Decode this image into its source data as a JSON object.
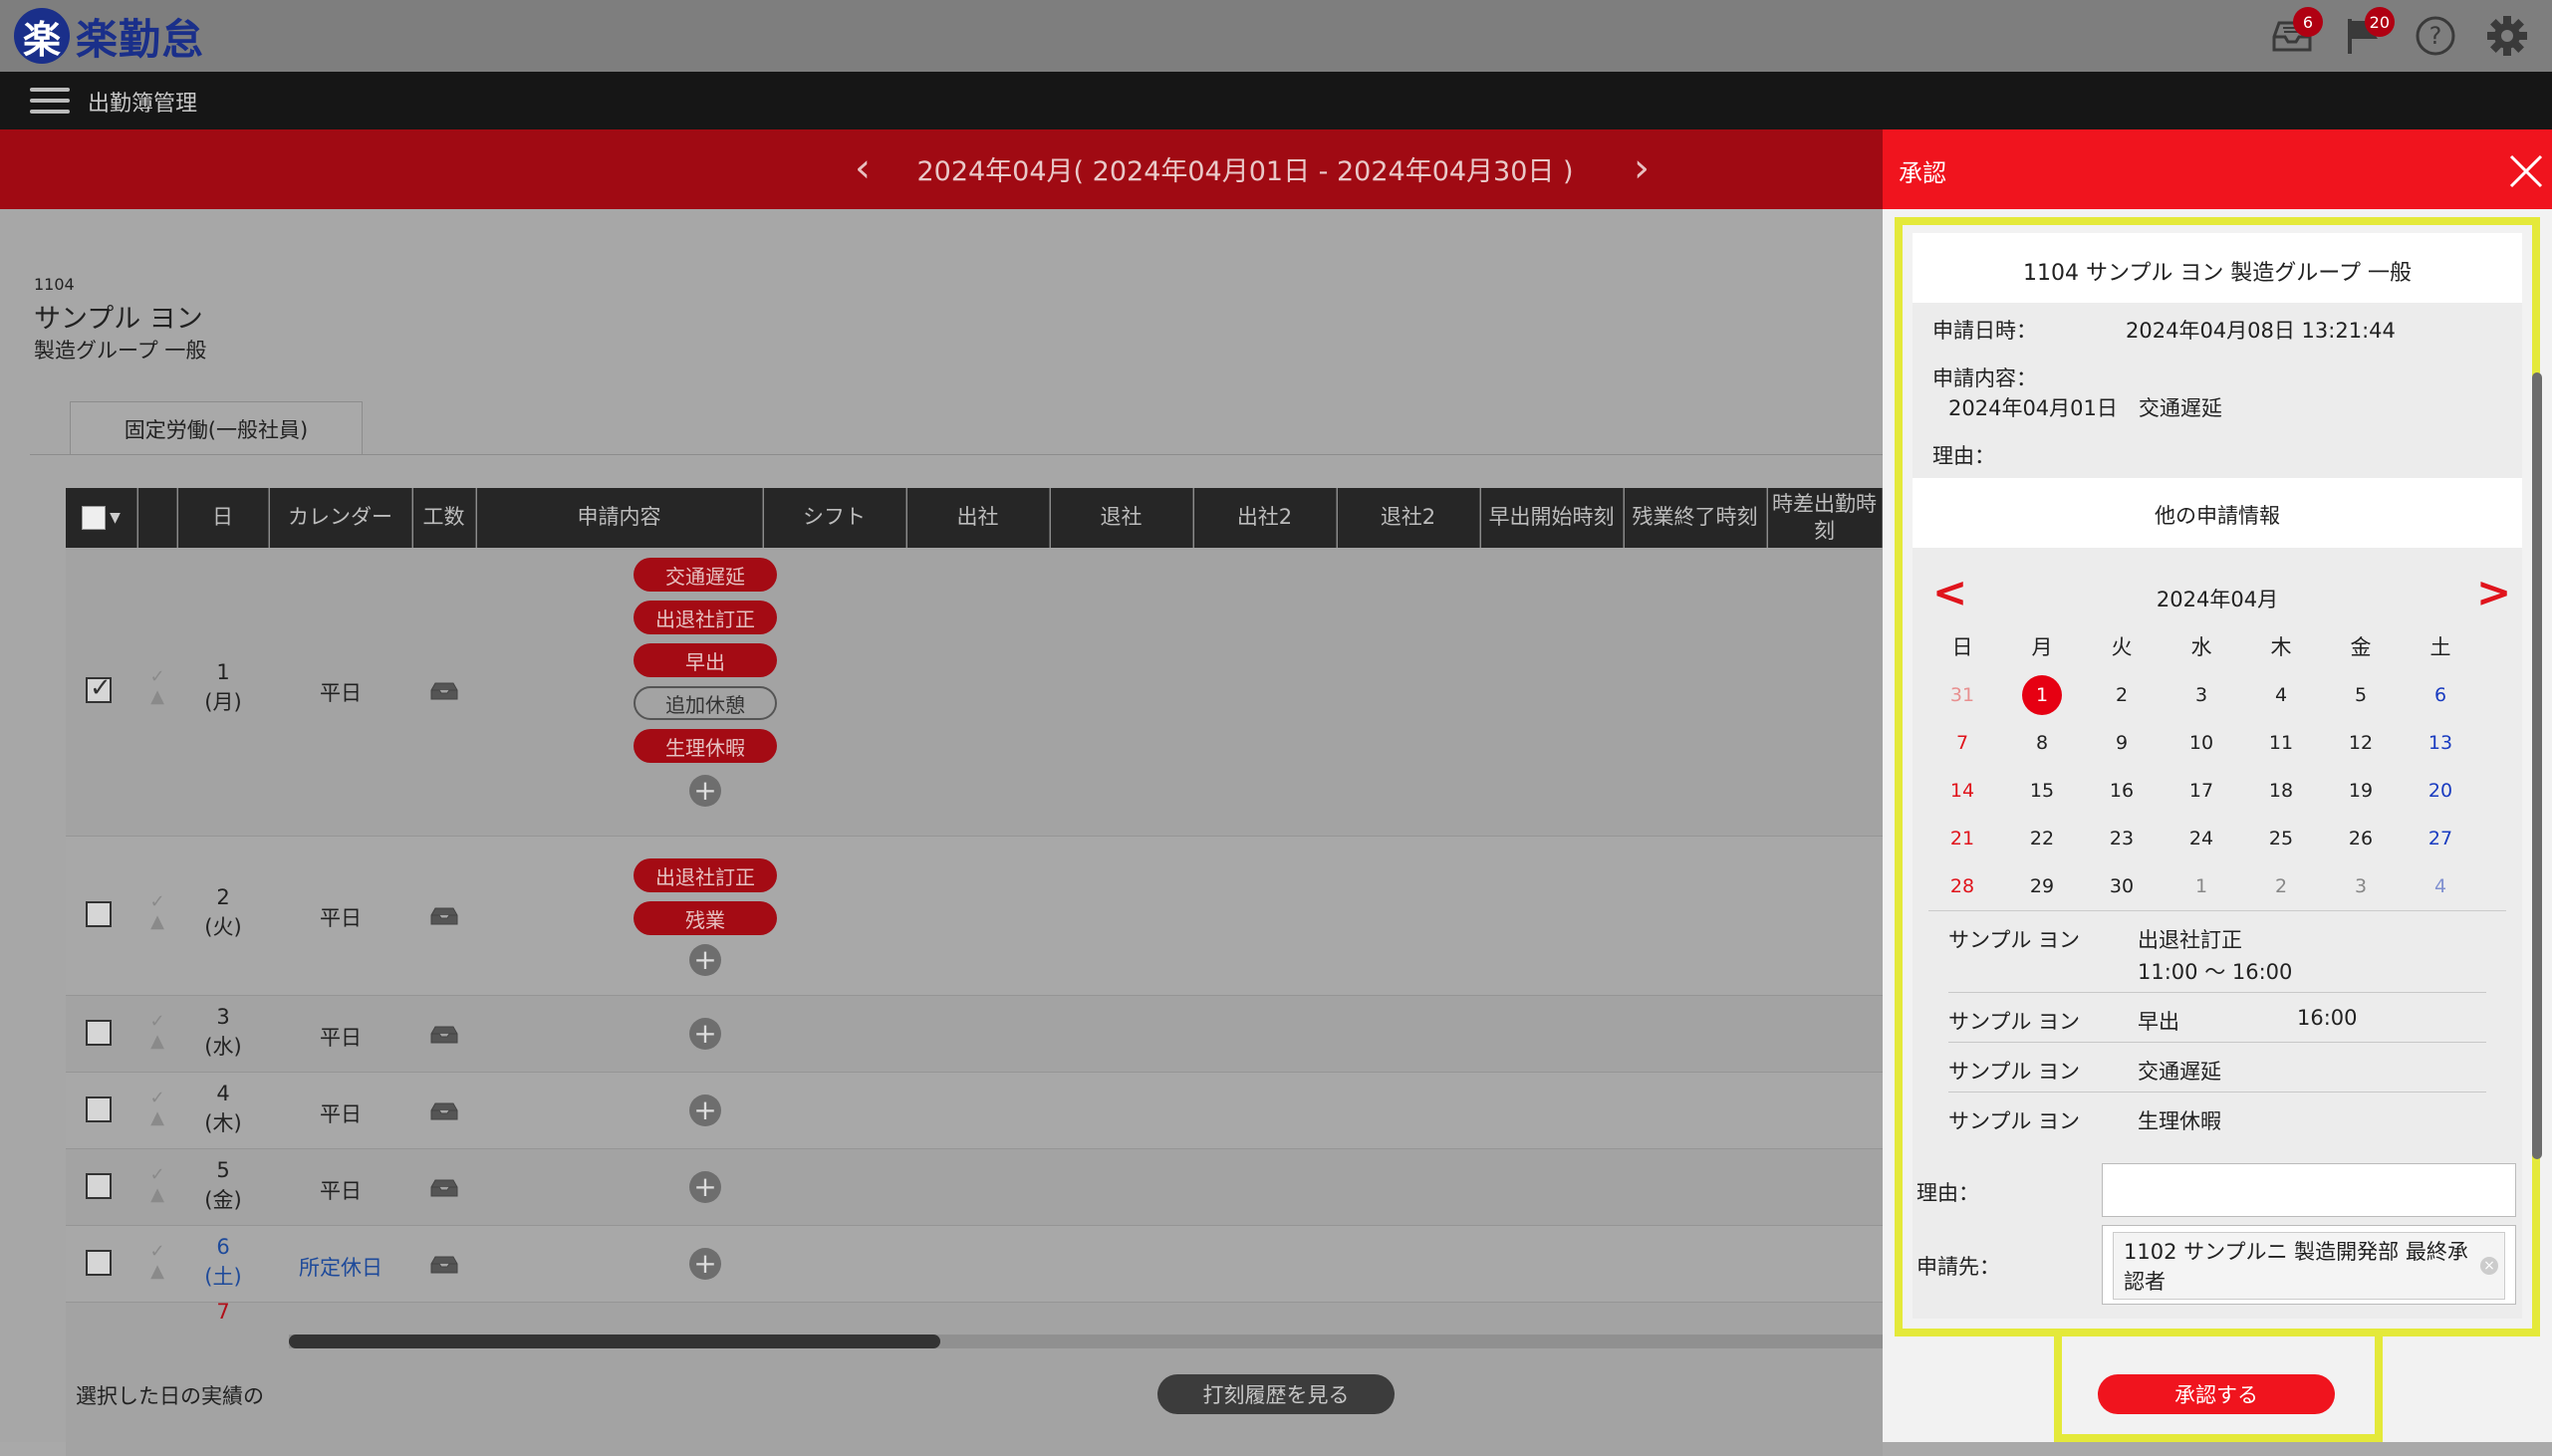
{
  "app": {
    "logo_mark": "楽",
    "logo_text": "楽勤怠"
  },
  "top_icons": [
    {
      "name": "inbox-icon",
      "badge": "6"
    },
    {
      "name": "flag-icon",
      "badge": "20"
    },
    {
      "name": "help-icon",
      "badge": ""
    },
    {
      "name": "gear-icon",
      "badge": ""
    }
  ],
  "menu": {
    "title": "出勤簿管理"
  },
  "month_nav": {
    "prev": "‹",
    "next": "›",
    "label": "2024年04月( 2024年04月01日 - 2024年04月30日 )"
  },
  "employee": {
    "id": "1104",
    "name": "サンプル ヨン",
    "dept": "製造グループ 一般"
  },
  "tab": {
    "label": "固定労働(一般社員)"
  },
  "table": {
    "headers": [
      "日",
      "カレンダー",
      "工数",
      "申請内容",
      "シフト",
      "出社",
      "退社",
      "出社2",
      "退社2",
      "早出開始時刻",
      "残業終了時刻",
      "時差出勤時刻"
    ],
    "rows": [
      {
        "day": "1",
        "dow": "(月)",
        "calendar": "平日",
        "checked": true,
        "pills": [
          "交通遅延",
          "出退社訂正",
          "早出",
          "追加休憩",
          "生理休暇"
        ]
      },
      {
        "day": "2",
        "dow": "(火)",
        "calendar": "平日",
        "checked": false,
        "pills": [
          "出退社訂正",
          "残業"
        ]
      },
      {
        "day": "3",
        "dow": "(水)",
        "calendar": "平日",
        "checked": false,
        "pills": []
      },
      {
        "day": "4",
        "dow": "(木)",
        "calendar": "平日",
        "checked": false,
        "pills": []
      },
      {
        "day": "5",
        "dow": "(金)",
        "calendar": "平日",
        "checked": false,
        "pills": []
      },
      {
        "day": "6",
        "dow": "(土)",
        "calendar": "所定休日",
        "checked": false,
        "pills": []
      },
      {
        "day": "7",
        "dow": "",
        "calendar": "",
        "checked": false,
        "pills": []
      }
    ]
  },
  "footer": {
    "selected_text": "選択した日の実績の",
    "history_button": "打刻履歴を見る"
  },
  "panel": {
    "title": "承認",
    "info_title": "1104 サンプル ヨン 製造グループ 一般",
    "apply_datetime_label": "申請日時：",
    "apply_datetime": "2024年04月08日 13:21:44",
    "apply_content_label": "申請内容：",
    "apply_content": "2024年04月01日　交通遅延",
    "reason_label": "理由：",
    "other_title": "他の申請情報",
    "calendar": {
      "prev": "<",
      "next": ">",
      "month": "2024年04月",
      "weekdays": [
        "日",
        "月",
        "火",
        "水",
        "木",
        "金",
        "土"
      ],
      "weeks": [
        [
          "31",
          "1",
          "2",
          "3",
          "4",
          "5",
          "6"
        ],
        [
          "7",
          "8",
          "9",
          "10",
          "11",
          "12",
          "13"
        ],
        [
          "14",
          "15",
          "16",
          "17",
          "18",
          "19",
          "20"
        ],
        [
          "21",
          "22",
          "23",
          "24",
          "25",
          "26",
          "27"
        ],
        [
          "28",
          "29",
          "30",
          "1",
          "2",
          "3",
          "4"
        ]
      ],
      "today": "1"
    },
    "requests": [
      {
        "name": "サンプル ヨン",
        "type": "出退社訂正",
        "detail": "11:00 ～ 16:00",
        "time": ""
      },
      {
        "name": "サンプル ヨン",
        "type": "早出",
        "detail": "",
        "time": "16:00"
      },
      {
        "name": "サンプル ヨン",
        "type": "交通遅延",
        "detail": "",
        "time": ""
      },
      {
        "name": "サンプル ヨン",
        "type": "生理休暇",
        "detail": "",
        "time": ""
      }
    ],
    "reason_input_label": "理由：",
    "reason_value": "",
    "destination_label": "申請先：",
    "destination": "1102 サンプルニ 製造開発部 最終承認者",
    "approve_button": "承認する"
  },
  "colors": {
    "brand_red": "#f0141e",
    "highlight": "#e4e93a",
    "blue_day": "#1a3cc0"
  }
}
